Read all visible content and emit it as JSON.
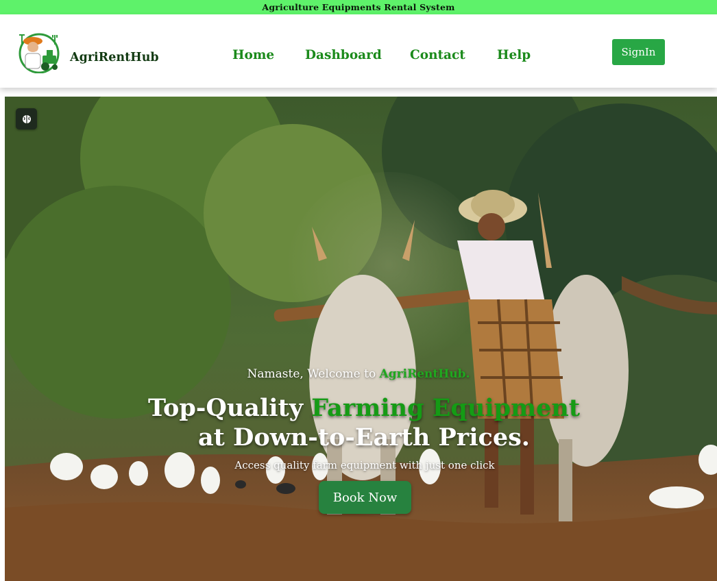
{
  "topbar": {
    "title": "Agriculture Equipments Rental System"
  },
  "brand": {
    "name": "AgriRentHub",
    "logo_icon": "farmer-tractor-logo"
  },
  "nav": {
    "links": [
      {
        "label": "Home"
      },
      {
        "label": "Dashboard"
      },
      {
        "label": "Contact"
      },
      {
        "label": "Help"
      }
    ],
    "signin_label": "SignIn"
  },
  "hero": {
    "badge_icon": "brain-icon",
    "welcome_prefix": "Namaste, Welcome to ",
    "welcome_brand": "AgriRentHub.",
    "headline_part1": "Top-Quality ",
    "headline_highlight": "Farming Equipment",
    "headline_part2": "at Down-to-Earth Prices.",
    "subtext": "Access quality farm equipment with just one click",
    "cta_label": "Book Now"
  },
  "colors": {
    "topbar_bg": "#5ef26a",
    "nav_link": "#1b8a1b",
    "signin_bg": "#28a745",
    "cta_bg": "#27823f",
    "highlight": "#159b15"
  }
}
